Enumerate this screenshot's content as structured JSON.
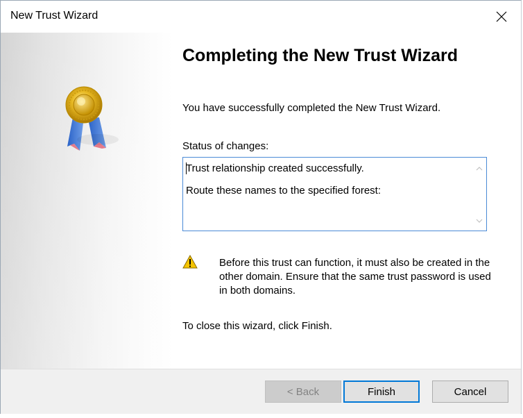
{
  "window": {
    "title": "New Trust Wizard"
  },
  "wizard": {
    "heading": "Completing the New Trust Wizard",
    "success_text": "You have successfully completed the New Trust Wizard.",
    "status_label": "Status of changes:",
    "status_lines": [
      "Trust relationship created successfully.",
      "Route these names to the specified forest:"
    ],
    "warning_text": "Before this trust can function, it must also be created in the other domain. Ensure that the same trust password is used in both domains.",
    "close_hint": "To close this wizard, click Finish."
  },
  "buttons": {
    "back": "< Back",
    "finish": "Finish",
    "cancel": "Cancel"
  },
  "icons": {
    "close": "close-icon",
    "medal": "award-medal-icon",
    "warning": "warning-icon"
  },
  "colors": {
    "focus_border": "#0078d7",
    "textbox_border": "#4a8ad6",
    "footer_bg": "#f0f0f0",
    "warning_yellow": "#f5c400"
  }
}
